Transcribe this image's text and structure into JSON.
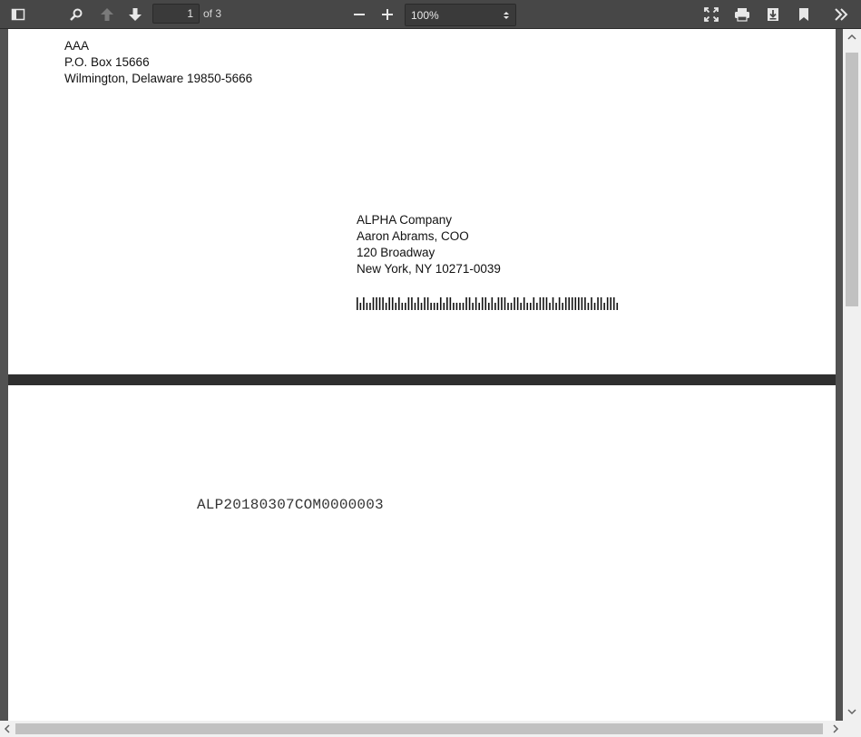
{
  "toolbar": {
    "page_current": "1",
    "page_total_label": "of 3",
    "zoom_value": "100%"
  },
  "page1": {
    "sender": {
      "line1": "AAA",
      "line2": "P.O. Box 15666",
      "line3": "Wilmington, Delaware 19850-5666"
    },
    "recipient": {
      "line1": "ALPHA Company",
      "line2": "Aaron Abrams, COO",
      "line3": "120 Broadway",
      "line4": "New York, NY 10271-0039"
    }
  },
  "page2": {
    "bates_number": "ALP20180307COM0000003"
  }
}
